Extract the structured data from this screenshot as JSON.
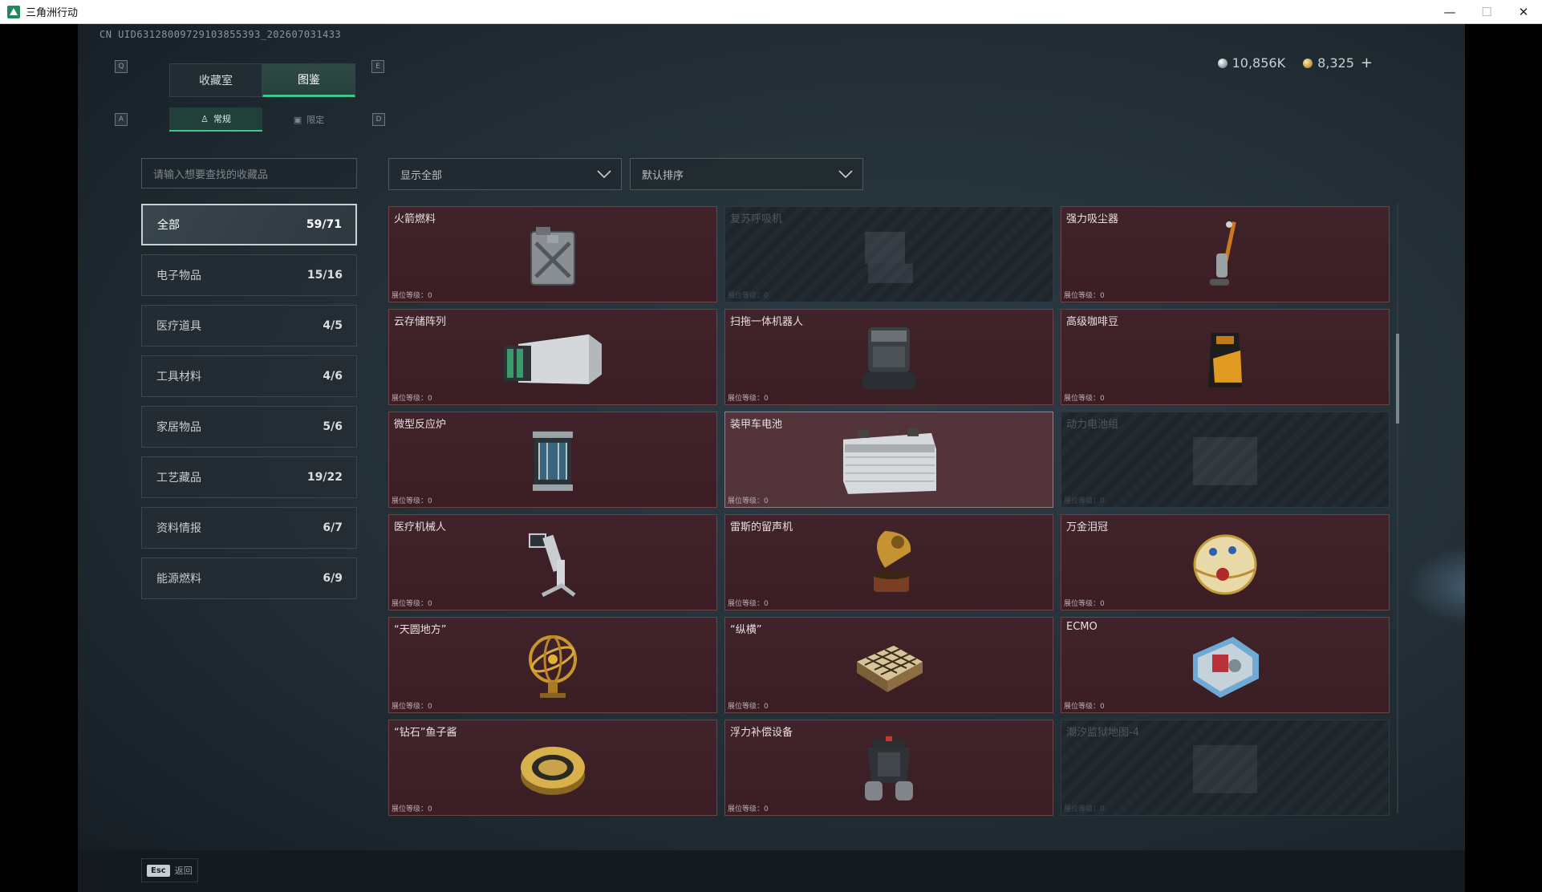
{
  "window": {
    "title": "三角洲行动",
    "minimize": "—",
    "maximize": "☐",
    "close": "✕"
  },
  "uid": "CN UID6312800972910385539​3_202607031433",
  "currency": {
    "silver": "10,856K",
    "gold": "8,325",
    "add": "+"
  },
  "tabs": {
    "left_key": "Q",
    "right_key": "E",
    "items": [
      {
        "label": "收藏室"
      },
      {
        "label": "图鉴"
      }
    ]
  },
  "subtabs": {
    "left_key": "A",
    "right_key": "D",
    "items": [
      {
        "label": "常规"
      },
      {
        "label": "限定"
      }
    ]
  },
  "search": {
    "placeholder": "请输入想要查找的收藏品"
  },
  "filters": {
    "show": "显示全部",
    "sort": "默认排序"
  },
  "categories": [
    {
      "label": "全部",
      "count": "59/71"
    },
    {
      "label": "电子物品",
      "count": "15/16"
    },
    {
      "label": "医疗道具",
      "count": "4/5"
    },
    {
      "label": "工具材料",
      "count": "4/6"
    },
    {
      "label": "家居物品",
      "count": "5/6"
    },
    {
      "label": "工艺藏品",
      "count": "19/22"
    },
    {
      "label": "资料情报",
      "count": "6/7"
    },
    {
      "label": "能源燃料",
      "count": "6/9"
    }
  ],
  "level_label": "展位等级：",
  "items": [
    {
      "name": "火箭燃料",
      "level": "0",
      "state": "unlocked",
      "icon": "jerrycan-icon"
    },
    {
      "name": "复苏呼吸机",
      "level": "0",
      "state": "locked",
      "icon": "ventilator-icon"
    },
    {
      "name": "强力吸尘器",
      "level": "0",
      "state": "unlocked",
      "icon": "vacuum-icon"
    },
    {
      "name": "云存储阵列",
      "level": "0",
      "state": "unlocked",
      "icon": "server-array-icon"
    },
    {
      "name": "扫拖一体机器人",
      "level": "0",
      "state": "unlocked",
      "icon": "robot-vacuum-icon"
    },
    {
      "name": "高级咖啡豆",
      "level": "0",
      "state": "unlocked",
      "icon": "coffee-bag-icon"
    },
    {
      "name": "微型反应炉",
      "level": "0",
      "state": "unlocked",
      "icon": "reactor-icon"
    },
    {
      "name": "装甲车电池",
      "level": "0",
      "state": "highlight",
      "icon": "battery-icon"
    },
    {
      "name": "动力电池组",
      "level": "0",
      "state": "locked",
      "icon": "battery-pack-icon"
    },
    {
      "name": "医疗机械人",
      "level": "0",
      "state": "unlocked",
      "icon": "medical-robot-icon"
    },
    {
      "name": "雷斯的留声机",
      "level": "0",
      "state": "unlocked",
      "icon": "gramophone-icon"
    },
    {
      "name": "万金泪冠",
      "level": "0",
      "state": "unlocked",
      "icon": "jeweled-egg-icon"
    },
    {
      "name": "“天圆地方”",
      "level": "0",
      "state": "unlocked",
      "icon": "armillary-sphere-icon"
    },
    {
      "name": "“纵横”",
      "level": "0",
      "state": "unlocked",
      "icon": "chess-board-icon"
    },
    {
      "name": "ECMO",
      "level": "0",
      "state": "unlocked",
      "icon": "ecmo-icon"
    },
    {
      "name": "“钻石”鱼子酱",
      "level": "0",
      "state": "unlocked",
      "icon": "caviar-tin-icon"
    },
    {
      "name": "浮力补偿设备",
      "level": "0",
      "state": "unlocked",
      "icon": "bcd-vest-icon"
    },
    {
      "name": "潮汐监狱地图-4",
      "level": "0",
      "state": "locked",
      "icon": "map-icon"
    }
  ],
  "footer": {
    "esc_key": "Esc",
    "back_label": "返回"
  }
}
